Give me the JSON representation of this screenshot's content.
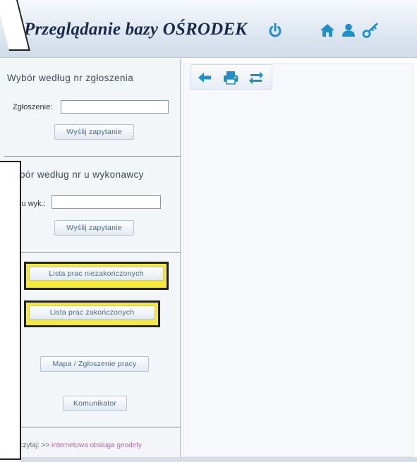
{
  "header": {
    "title": "Przeglądanie bazy OŚRODEK",
    "icons": [
      "power-icon",
      "home-icon",
      "user-icon",
      "key-icon"
    ]
  },
  "sidebar": {
    "section1": {
      "title": "Wybór według nr zgłoszenia",
      "field_label": "Zgłoszenie:",
      "field_value": "",
      "button": "Wyślij zapytanie"
    },
    "section2": {
      "title": "bór według nr u wykonawcy",
      "field_label": "s u wyk.:",
      "field_value": "",
      "button": "Wyślij zapytanie"
    },
    "buttons": {
      "unfinished": "Lista prac niezakończonych",
      "finished": "Lista prac zakończonych",
      "map": "Mapa / Zgłoszenie pracy",
      "messenger": "Komunikator"
    },
    "footer": {
      "prefix": "eczytaj: >>",
      "link": "internetowa obsługa geodety"
    }
  },
  "toolbar": {
    "icons": [
      "back-arrow-icon",
      "print-icon",
      "refresh-icon"
    ]
  },
  "colors": {
    "accent": "#1e8fc8",
    "highlight": "#f5e93a",
    "link": "#b066a8"
  }
}
